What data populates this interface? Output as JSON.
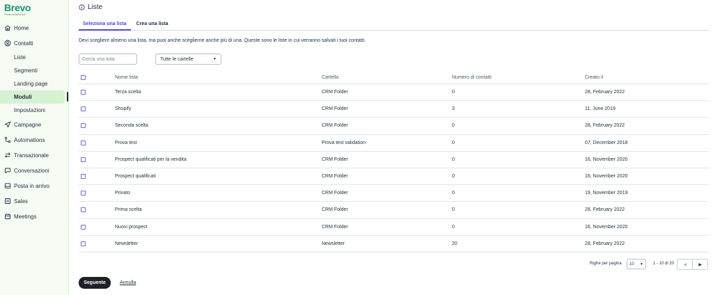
{
  "brand": {
    "name": "Brevo",
    "tagline": "Prima sendinblue",
    "color": "#0b996e"
  },
  "sidebar": {
    "items": [
      {
        "label": "Home",
        "icon": "home-icon"
      },
      {
        "label": "Contatti",
        "icon": "contacts-icon"
      },
      {
        "label": "Liste",
        "sub": true
      },
      {
        "label": "Segmenti",
        "sub": true
      },
      {
        "label": "Landing page",
        "sub": true
      },
      {
        "label": "Moduli",
        "sub": true,
        "active": true
      },
      {
        "label": "Impostazioni",
        "sub": true
      },
      {
        "label": "Campagne",
        "icon": "send-icon"
      },
      {
        "label": "Automations",
        "icon": "automation-icon"
      },
      {
        "label": "Transazionale",
        "icon": "arrows-icon"
      },
      {
        "label": "Conversazioni",
        "icon": "chat-icon"
      },
      {
        "label": "Posta in arrivo",
        "icon": "inbox-icon"
      },
      {
        "label": "Sales",
        "icon": "sales-icon"
      },
      {
        "label": "Meetings",
        "icon": "calendar-icon"
      }
    ]
  },
  "page": {
    "title": "Liste",
    "title_icon": "info-icon"
  },
  "tabs": [
    {
      "label": "Seleziona una lista",
      "active": true
    },
    {
      "label": "Crea una lista",
      "active": false
    }
  ],
  "description": "Devi scegliere almeno una lista, ma puoi anche sceglierne anche più di una. Queste sono le liste in cui verranno salvati i tuoi contatti.",
  "filters": {
    "search_placeholder": "Cerca una lista",
    "folder_select": "Tutte le cartelle"
  },
  "table": {
    "headers": [
      "Nome lista",
      "Cartella",
      "Numero di contatti",
      "Creato il"
    ],
    "rows": [
      [
        "Terza scelta",
        "CRM Folder",
        "0",
        "28, February 2022"
      ],
      [
        "Shopify",
        "CRM Folder",
        "3",
        "11, June 2019"
      ],
      [
        "Seconda scelta",
        "CRM Folder",
        "0",
        "28, February 2022"
      ],
      [
        "Prova test",
        "Prova test validation",
        "0",
        "07, December 2018"
      ],
      [
        "Prospect qualificati per la vendita",
        "CRM Folder",
        "0",
        "16, November 2020"
      ],
      [
        "Prospect qualificati",
        "CRM Folder",
        "0",
        "16, November 2020"
      ],
      [
        "Privato",
        "CRM Folder",
        "0",
        "19, November 2019"
      ],
      [
        "Prima scelta",
        "CRM Folder",
        "0",
        "28, February 2022"
      ],
      [
        "Nuovi prospect",
        "CRM Folder",
        "0",
        "16, November 2020"
      ],
      [
        "Newsletter",
        "Newsletter",
        "20",
        "28, February 2022"
      ]
    ]
  },
  "pagination": {
    "per_page_label": "Righe per pagina",
    "per_page_value": "10",
    "range": "1 - 10 di 20"
  },
  "actions": {
    "primary": "Seguente",
    "secondary": "Annulla"
  },
  "colors": {
    "accent": "#4a4ad9",
    "sidebar_bg": "#f6fbf3",
    "active_item_bg": "#d6f2d3",
    "primary_button": "#1f2126"
  }
}
